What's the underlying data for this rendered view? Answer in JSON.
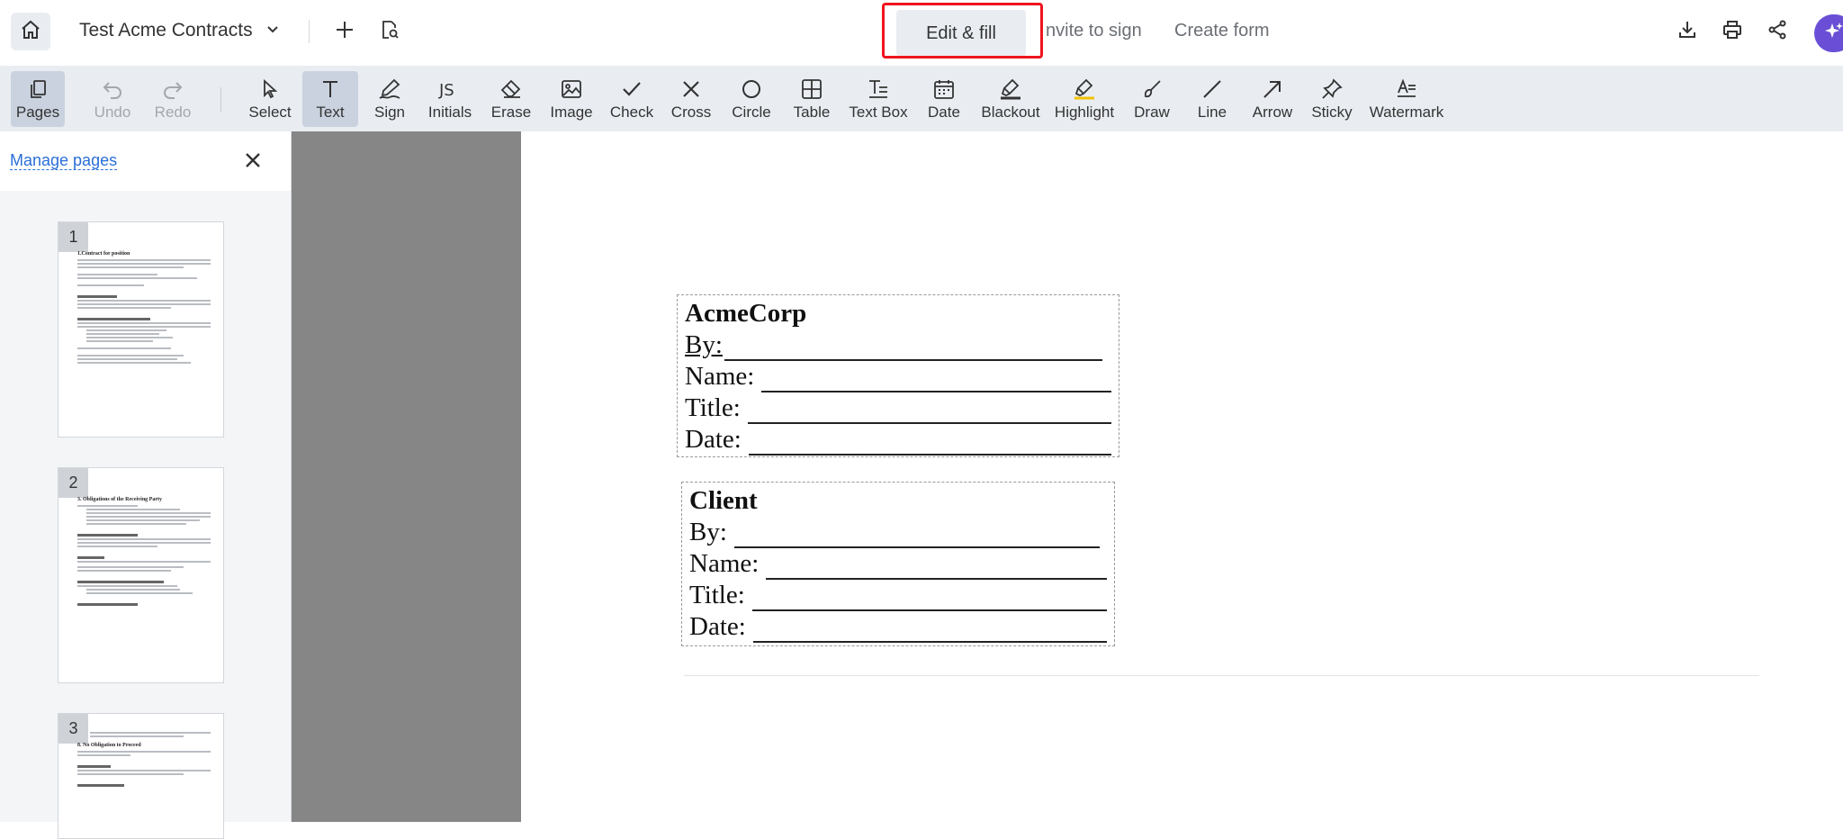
{
  "header": {
    "doc_title": "Test Acme Contracts",
    "tabs": [
      {
        "label": "Edit & fill",
        "active": true
      },
      {
        "label": "Invite to sign",
        "visible_text": "nvite to sign"
      },
      {
        "label": "Create form"
      }
    ],
    "icons": [
      "home-icon",
      "chevron-down-icon",
      "plus-icon",
      "search-document-icon",
      "download-icon",
      "print-icon",
      "share-icon",
      "ai-assistant-icon"
    ],
    "accent_color": "#6a4fd6",
    "highlight_color": "#f0141e"
  },
  "toolbar": {
    "pages": "Pages",
    "undo": "Undo",
    "redo": "Redo",
    "tools": [
      "Select",
      "Text",
      "Sign",
      "Initials",
      "Erase",
      "Image",
      "Check",
      "Cross",
      "Circle",
      "Table",
      "Text Box",
      "Date",
      "Blackout",
      "Highlight",
      "Draw",
      "Line",
      "Arrow",
      "Sticky",
      "Watermark"
    ],
    "active_tool": "Text",
    "bg_color": "#e9edf2"
  },
  "left_panel": {
    "manage_pages": "Manage pages",
    "thumbnails": [
      {
        "num": "1",
        "heading": "1.Contract for position"
      },
      {
        "num": "2",
        "heading": "3. Obligations of the Receiving Party"
      },
      {
        "num": "3",
        "heading": "8. No Obligation to Proceed"
      }
    ]
  },
  "document": {
    "blocks": [
      {
        "title": "AcmeCorp",
        "by": "By:",
        "name": "Name:",
        "title_field": "Title:",
        "date": "Date:"
      },
      {
        "title": "Client",
        "by": "By:",
        "name": "Name:",
        "title_field": "Title:",
        "date": "Date:"
      }
    ]
  }
}
